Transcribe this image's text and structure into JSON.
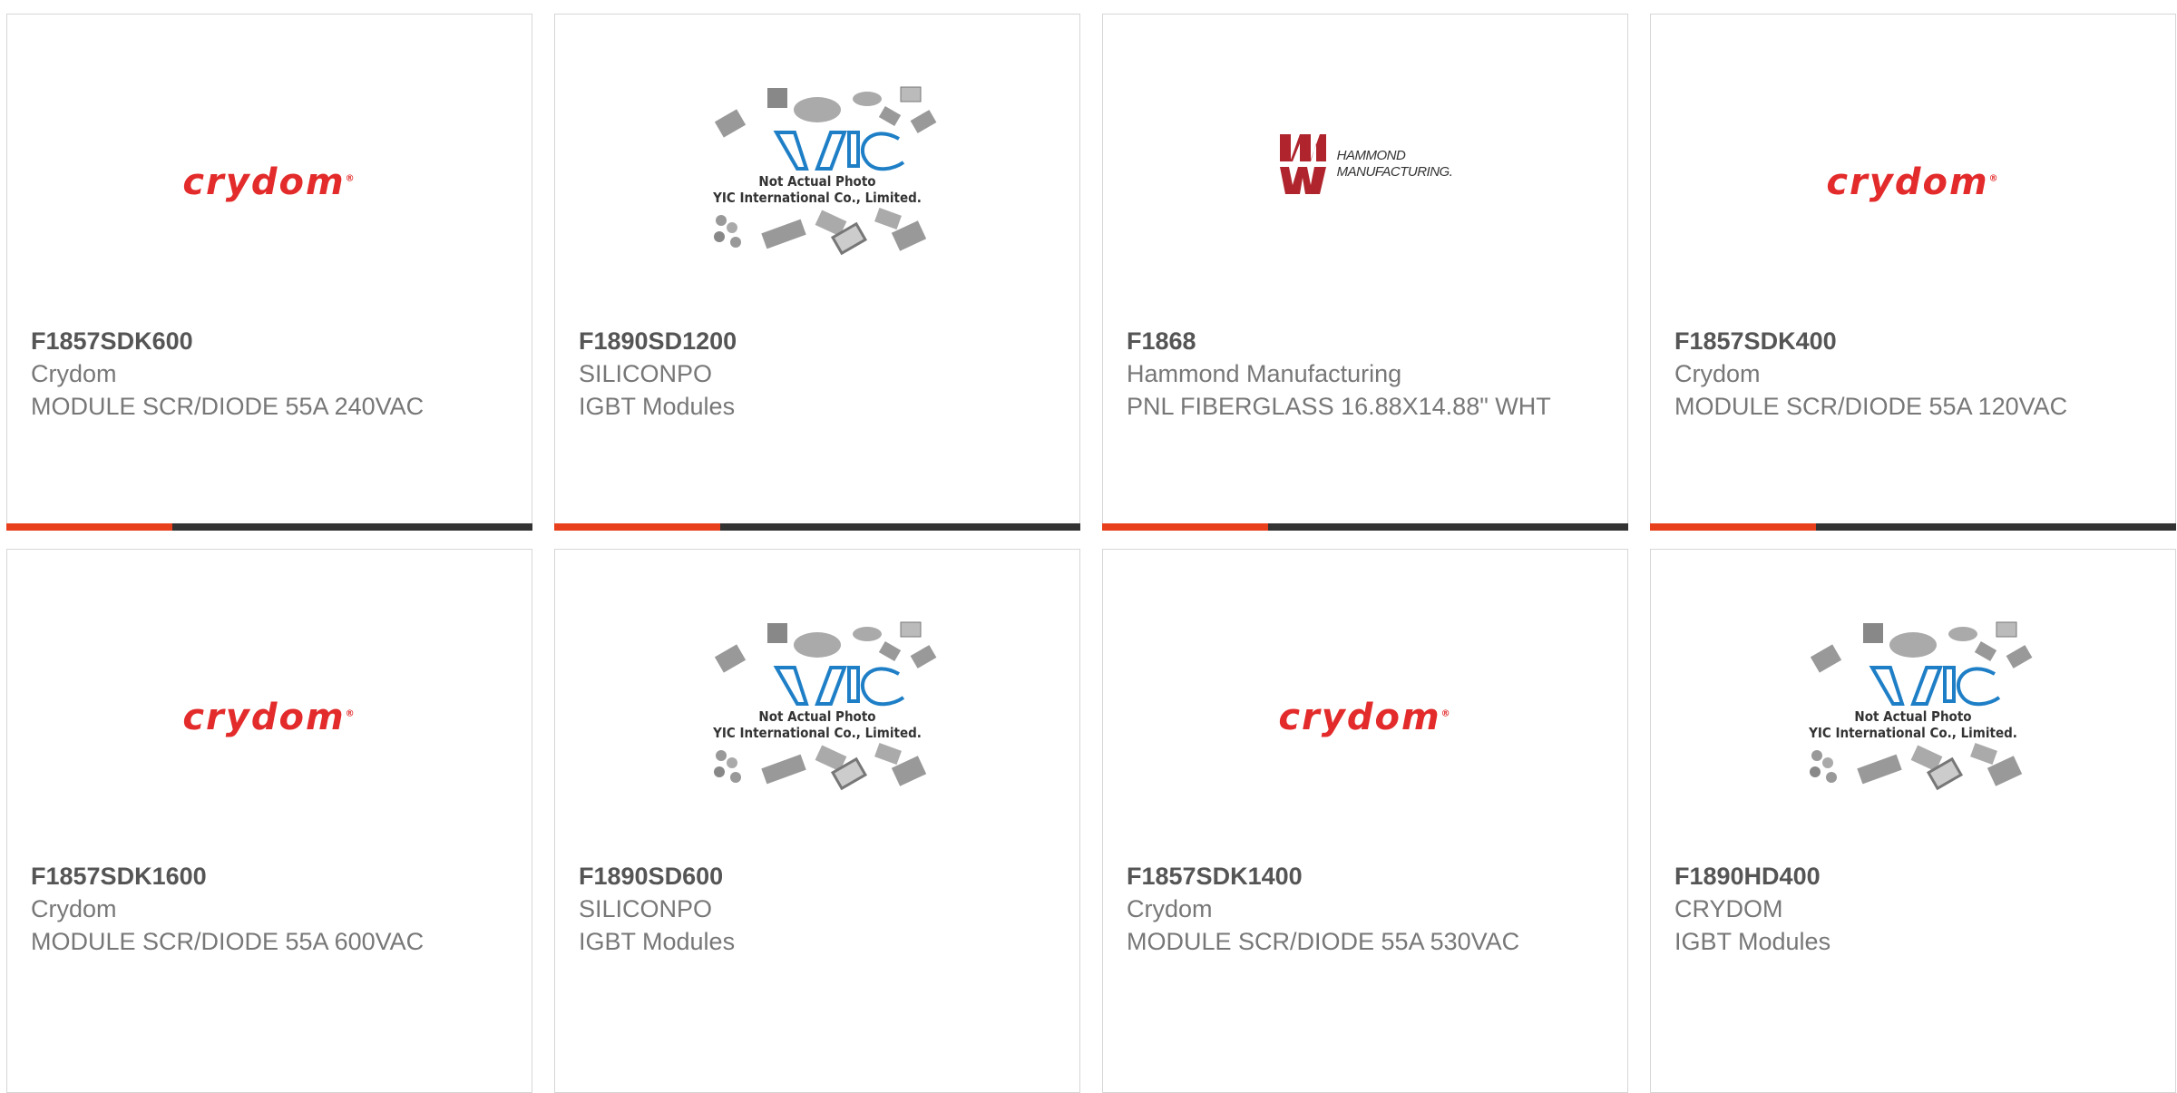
{
  "products": [
    {
      "part": "F1857SDK600",
      "maker": "Crydom",
      "desc": "MODULE SCR/DIODE 55A 240VAC",
      "logo": "crydom"
    },
    {
      "part": "F1890SD1200",
      "maker": "SILICONPO",
      "desc": "IGBT Modules",
      "logo": "yic"
    },
    {
      "part": "F1868",
      "maker": "Hammond Manufacturing",
      "desc": "PNL FIBERGLASS 16.88X14.88\" WHT",
      "logo": "hammond"
    },
    {
      "part": "F1857SDK400",
      "maker": "Crydom",
      "desc": "MODULE SCR/DIODE 55A 120VAC",
      "logo": "crydom"
    },
    {
      "part": "F1857SDK1600",
      "maker": "Crydom",
      "desc": "MODULE SCR/DIODE 55A 600VAC",
      "logo": "crydom"
    },
    {
      "part": "F1890SD600",
      "maker": "SILICONPO",
      "desc": "IGBT Modules",
      "logo": "yic"
    },
    {
      "part": "F1857SDK1400",
      "maker": "Crydom",
      "desc": "MODULE SCR/DIODE 55A 530VAC",
      "logo": "crydom"
    },
    {
      "part": "F1890HD400",
      "maker": "CRYDOM",
      "desc": "IGBT Modules",
      "logo": "yic"
    }
  ],
  "logos": {
    "crydom": "crydom",
    "hammond_line1": "HAMMOND",
    "hammond_line2": "MANUFACTURING.",
    "yic_caption1": "Not Actual Photo",
    "yic_caption2": "YIC International Co., Limited."
  },
  "colors": {
    "accent": "#e8401c",
    "bar": "#333333",
    "crydom_red": "#e32b2b",
    "yic_blue": "#1f7fc6"
  }
}
